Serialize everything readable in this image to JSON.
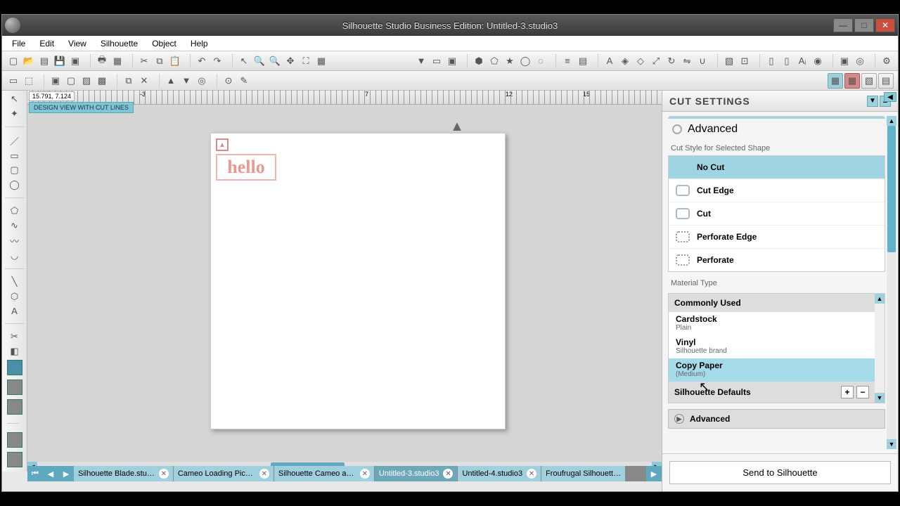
{
  "window": {
    "title": "Silhouette Studio Business Edition: Untitled-3.studio3"
  },
  "menu": {
    "items": [
      "File",
      "Edit",
      "View",
      "Silhouette",
      "Object",
      "Help"
    ]
  },
  "canvas": {
    "coord": "15.791, 7.124",
    "ruler_marks": {
      "m1": "-3",
      "m2": "7",
      "m3": "12",
      "m4": "15"
    },
    "design_view_label": "DESIGN VIEW WITH CUT LINES",
    "hello_text": "hello"
  },
  "doc_tabs": {
    "items": [
      {
        "label": "Silhouette Blade.stu…"
      },
      {
        "label": "Cameo Loading Pict…"
      },
      {
        "label": "Silhouette Cameo an…"
      },
      {
        "label": "Untitled-3.studio3",
        "active": true
      },
      {
        "label": "Untitled-4.studio3"
      },
      {
        "label": "Froufrugal Silhouett…"
      }
    ]
  },
  "panel": {
    "title": "CUT SETTINGS",
    "advanced_radio": "Advanced",
    "cut_style_label": "Cut Style for Selected Shape",
    "cut_styles": {
      "no_cut": "No Cut",
      "cut_edge": "Cut Edge",
      "cut": "Cut",
      "perf_edge": "Perforate Edge",
      "perf": "Perforate"
    },
    "material_label": "Material Type",
    "material": {
      "commonly_used": "Commonly Used",
      "cardstock": "Cardstock",
      "cardstock_sub": "Plain",
      "vinyl": "Vinyl",
      "vinyl_sub": "Silhouette brand",
      "copy_paper": "Copy Paper",
      "copy_paper_sub": "(Medium)",
      "defaults": "Silhouette Defaults",
      "plus": "+",
      "minus": "−"
    },
    "advanced_expand": "Advanced",
    "send": "Send to Silhouette"
  }
}
